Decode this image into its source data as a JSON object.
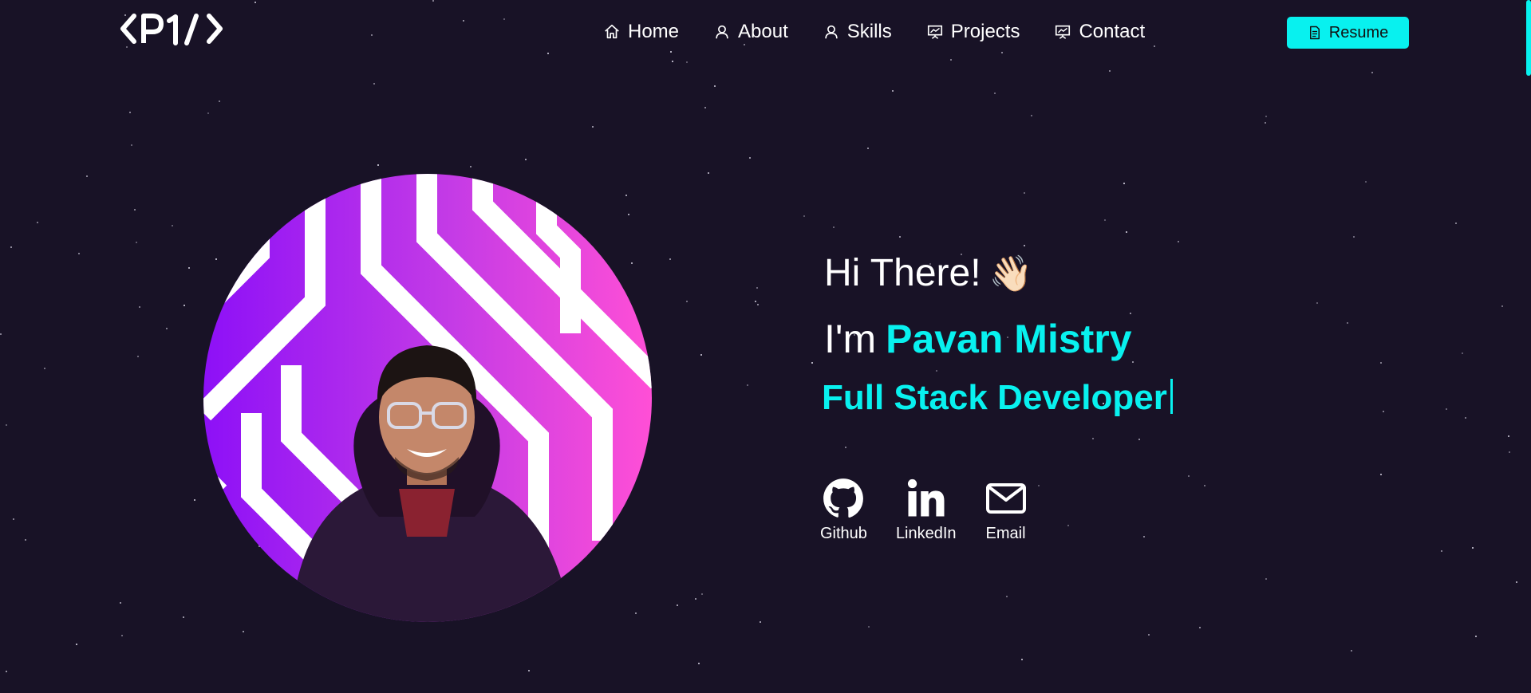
{
  "logo": {
    "text": "<P1/>"
  },
  "nav": {
    "items": [
      {
        "label": "Home",
        "icon": "home-icon"
      },
      {
        "label": "About",
        "icon": "user-icon"
      },
      {
        "label": "Skills",
        "icon": "user-icon"
      },
      {
        "label": "Projects",
        "icon": "presentation-icon"
      },
      {
        "label": "Contact",
        "icon": "presentation-icon"
      }
    ],
    "resume_label": "Resume"
  },
  "hero": {
    "greeting": "Hi There!",
    "greeting_emoji": "👋🏻",
    "intro_prefix": "I'm",
    "name": "Pavan Mistry",
    "role": "Full Stack Developer"
  },
  "socials": [
    {
      "label": "Github",
      "icon": "github-icon"
    },
    {
      "label": "LinkedIn",
      "icon": "linkedin-icon"
    },
    {
      "label": "Email",
      "icon": "mail-icon"
    }
  ],
  "colors": {
    "background": "#181226",
    "accent": "#08f1ef",
    "avatar_gradient_start": "#8d10f7",
    "avatar_gradient_end": "#ff4fd6"
  }
}
